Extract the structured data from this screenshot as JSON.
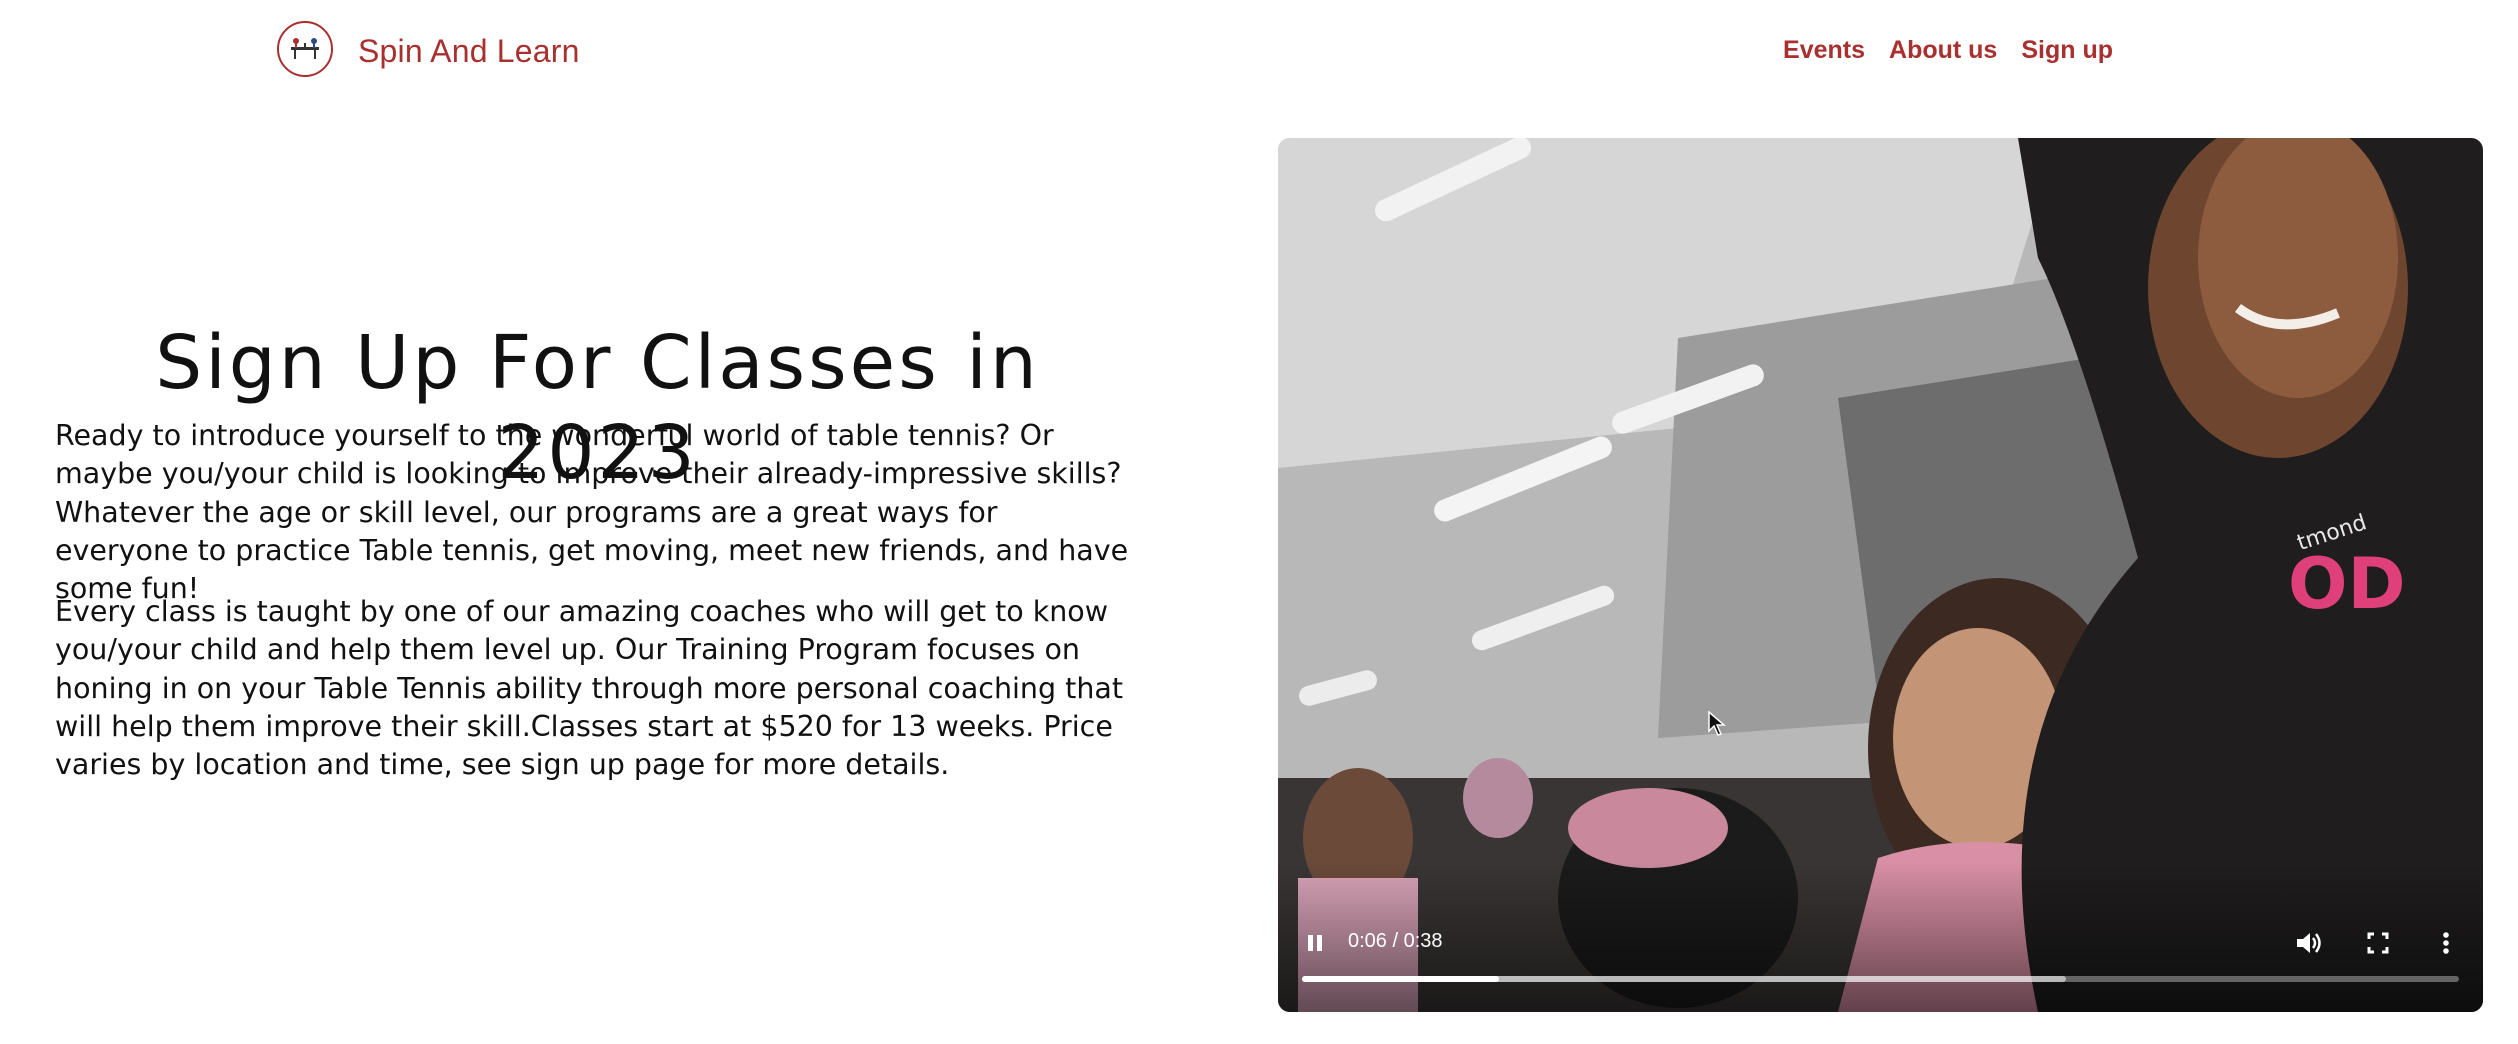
{
  "header": {
    "brand": "Spin And Learn",
    "nav": {
      "events": "Events",
      "about": "About us",
      "signup": "Sign up"
    },
    "logo_icon": "table-tennis-logo-icon"
  },
  "main": {
    "title": "Sign Up For Classes in 2023",
    "paragraph1": "Ready to introduce yourself to the wonderful world of table tennis? Or maybe you/your child is looking to improve their already-impressive skills? Whatever the age or skill level, our programs are a great ways for everyone to practice Table tennis, get moving, meet new friends, and have some fun!",
    "paragraph2": "Every class is taught by one of our amazing coaches who will get to know you/your child and help them level up. Our Training Program focuses on honing in on your Table Tennis ability through more personal coaching that will help them improve their skill.Classes start at $520 for 13 weeks. Price varies by location and time, see sign up page for more details."
  },
  "video": {
    "time": "0:06 / 0:38",
    "state": "playing",
    "played_fraction": 0.17,
    "buffered_fraction": 0.66,
    "icons": [
      "pause-icon",
      "volume-icon",
      "fullscreen-icon",
      "more-options-icon"
    ]
  },
  "colors": {
    "brand": "#a8302f"
  }
}
